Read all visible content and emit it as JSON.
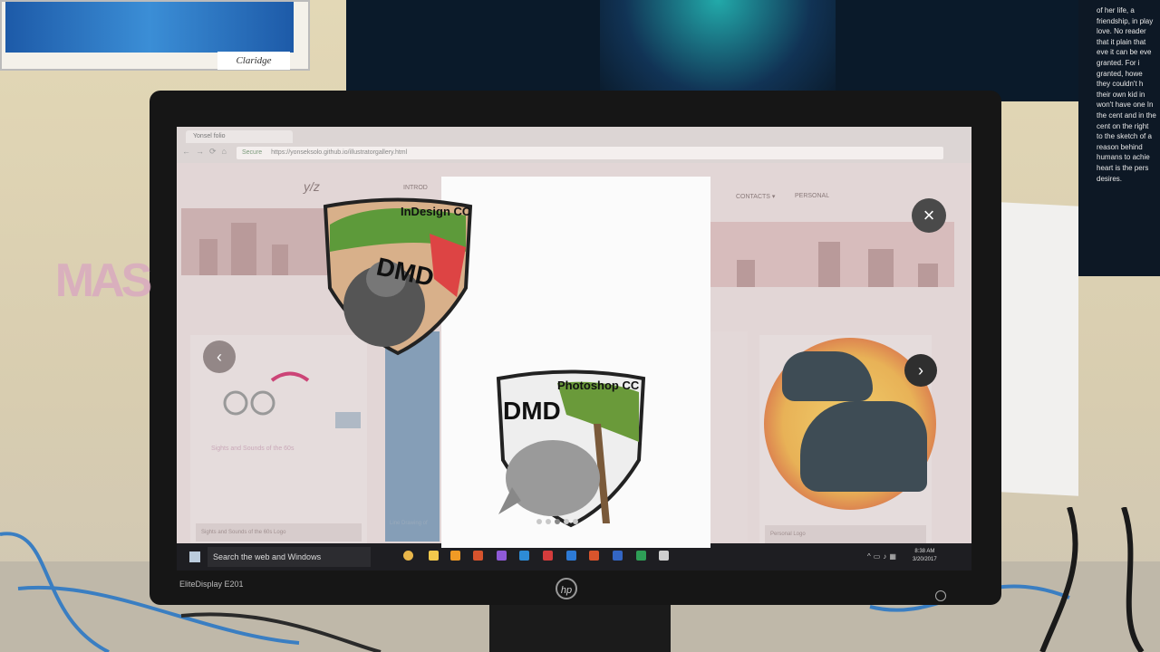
{
  "room": {
    "poster_brand": "Claridge",
    "poster_text": "of her life, a friendship, in play love. No reader that it plain that eve it can be eve granted. For i granted, howe they couldn't h their own kid in won't have one In the cent and in the cent on the right to the sketch of a reason behind humans to achie heart is the pers desires."
  },
  "monitor": {
    "model_label": "EliteDisplay E201",
    "brand": "hp"
  },
  "browser": {
    "tab_title": "Yonsel folio",
    "secure_label": "Secure",
    "url": "https://yonseksolo.github.io/illustratorgallery.html"
  },
  "website": {
    "logo": "y/z",
    "nav_intro": "INTROD",
    "nav_contacts": "CONTACTS ▾",
    "nav_personal": "PERSONAL",
    "card_left_caption": "Sights and Sounds of the 60s Logo",
    "card_left_art": "MAS",
    "card_left_subtitle": "Sights and Sounds of the 60s",
    "card_blue_caption": "Line Drawing of",
    "card_right_caption": "Personal Logo"
  },
  "lightbox": {
    "close_label": "×",
    "prev_label": "‹",
    "next_label": "›",
    "image_top_title": "InDesign CC",
    "image_top_letters": "DMD",
    "image_bottom_title": "Photoshop CC",
    "image_bottom_letters": "DMD",
    "dots_total": 5,
    "dots_active": 3
  },
  "taskbar": {
    "search_placeholder": "Search the web and Windows",
    "time": "8:38 AM",
    "date": "3/20/2017"
  },
  "colors": {
    "accent_dark": "#2f2f2f",
    "page_tint": "#e2d6d6"
  }
}
